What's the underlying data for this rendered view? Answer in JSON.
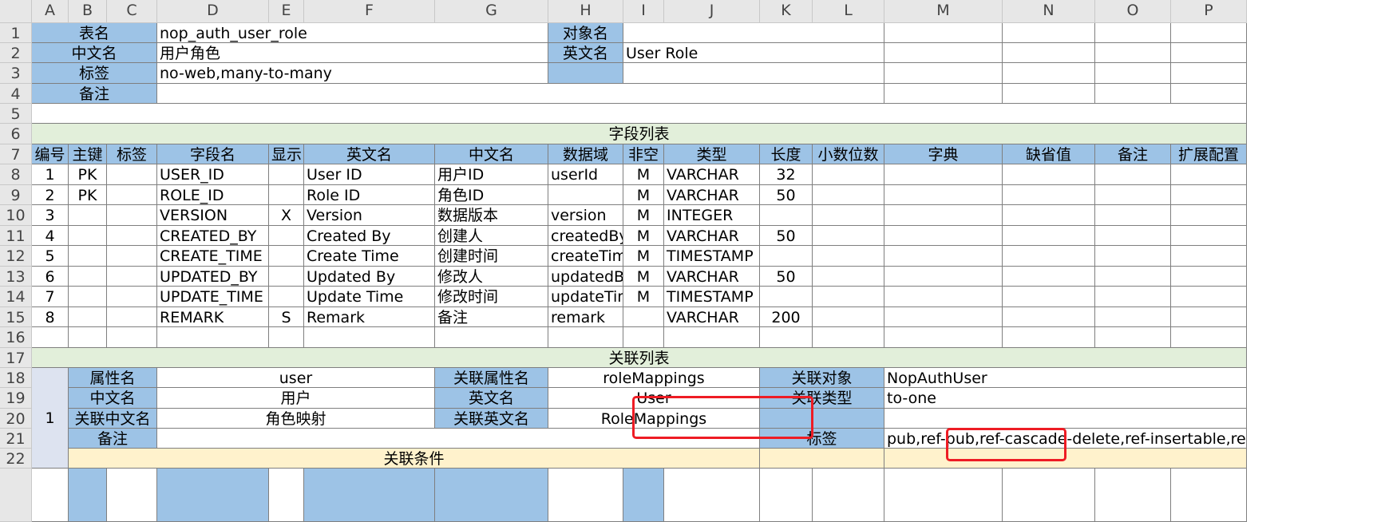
{
  "sheet": {
    "column_headers": [
      "A",
      "B",
      "C",
      "D",
      "E",
      "F",
      "G",
      "H",
      "I",
      "J",
      "K",
      "L",
      "M",
      "N",
      "O",
      "P"
    ],
    "row_headers": [
      "1",
      "2",
      "3",
      "4",
      "5",
      "6",
      "7",
      "8",
      "9",
      "10",
      "11",
      "12",
      "13",
      "14",
      "15",
      "16",
      "17",
      "18",
      "19",
      "20",
      "21",
      "22"
    ]
  },
  "meta": {
    "table_name_label": "表名",
    "table_name_value": "nop_auth_user_role",
    "object_name_label": "对象名",
    "object_name_value": "",
    "cn_name_label": "中文名",
    "cn_name_value": "用户角色",
    "en_name_label": "英文名",
    "en_name_value": "User Role",
    "tags_label": "标签",
    "tags_value": "no-web,many-to-many",
    "remark_label": "备注"
  },
  "fields": {
    "section_title": "字段列表",
    "headers": [
      "编号",
      "主键",
      "标签",
      "字段名",
      "显示",
      "英文名",
      "中文名",
      "数据域",
      "非空",
      "类型",
      "长度",
      "小数位数",
      "字典",
      "缺省值",
      "备注",
      "扩展配置"
    ],
    "rows": [
      [
        "1",
        "PK",
        "",
        "USER_ID",
        "",
        "User ID",
        "用户ID",
        "userId",
        "M",
        "VARCHAR",
        "32"
      ],
      [
        "2",
        "PK",
        "",
        "ROLE_ID",
        "",
        "Role ID",
        "角色ID",
        "",
        "M",
        "VARCHAR",
        "50"
      ],
      [
        "3",
        "",
        "",
        "VERSION",
        "X",
        "Version",
        "数据版本",
        "version",
        "M",
        "INTEGER",
        ""
      ],
      [
        "4",
        "",
        "",
        "CREATED_BY",
        "",
        "Created By",
        "创建人",
        "createdBy",
        "M",
        "VARCHAR",
        "50"
      ],
      [
        "5",
        "",
        "",
        "CREATE_TIME",
        "",
        "Create Time",
        "创建时间",
        "createTime",
        "M",
        "TIMESTAMP",
        ""
      ],
      [
        "6",
        "",
        "",
        "UPDATED_BY",
        "",
        "Updated By",
        "修改人",
        "updatedBy",
        "M",
        "VARCHAR",
        "50"
      ],
      [
        "7",
        "",
        "",
        "UPDATE_TIME",
        "",
        "Update Time",
        "修改时间",
        "updateTime",
        "M",
        "TIMESTAMP",
        ""
      ],
      [
        "8",
        "",
        "",
        "REMARK",
        "S",
        "Remark",
        "备注",
        "remark",
        "",
        "VARCHAR",
        "200"
      ]
    ]
  },
  "relations": {
    "section_title": "关联列表",
    "index": "1",
    "prop_name_label": "属性名",
    "prop_name_value": "user",
    "ref_prop_label": "关联属性名",
    "ref_prop_value": "roleMappings",
    "ref_object_label": "关联对象",
    "ref_object_value": "NopAuthUser",
    "cn_name_label": "中文名",
    "cn_name_value": "用户",
    "en_name_label": "英文名",
    "en_name_value": "User",
    "ref_type_label": "关联类型",
    "ref_type_value": "to-one",
    "ref_cn_label": "关联中文名",
    "ref_cn_value": "角色映射",
    "ref_en_label": "关联英文名",
    "ref_en_value": "RoleMappings",
    "remark_label": "备注",
    "tags_label": "标签",
    "tags_value": "pub,ref-pub,ref-cascade-delete,ref-insertable,ref-up",
    "conditions_label": "关联条件"
  },
  "colors": {
    "header_blue": "#9dc3e6",
    "section_green": "#e2efda",
    "condition_yellow": "#fff2cc",
    "highlight_red": "#ee1c24"
  }
}
